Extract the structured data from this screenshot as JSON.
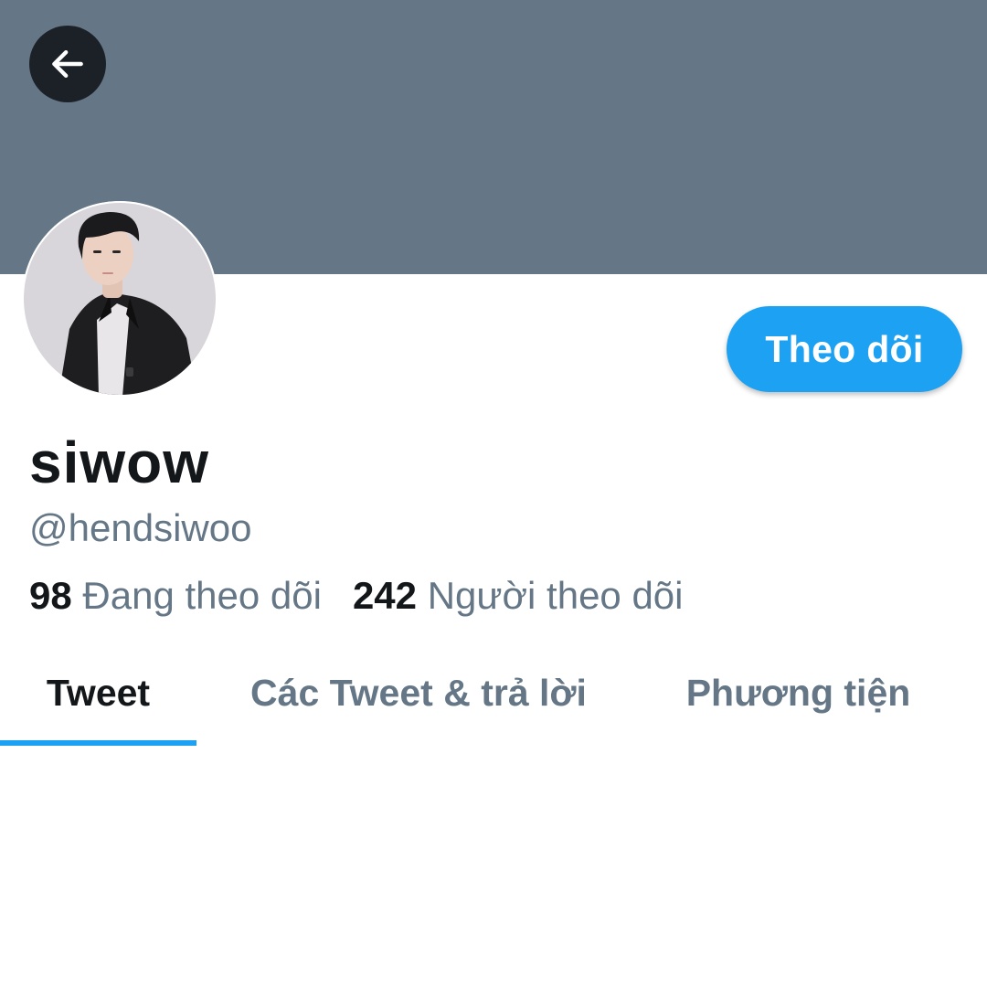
{
  "colors": {
    "banner": "#657786",
    "accent": "#1da1f2",
    "primary_text": "#14171a",
    "secondary_text": "#657786"
  },
  "header": {
    "back_icon": "arrow-left-icon"
  },
  "profile": {
    "display_name": "siwow",
    "handle": "@hendsiwoo",
    "follow_label": "Theo dõi",
    "stats": {
      "following_count": "98",
      "following_label": "Đang theo dõi",
      "followers_count": "242",
      "followers_label": "Người theo dõi"
    }
  },
  "tabs": [
    {
      "label": "Tweet",
      "active": true
    },
    {
      "label": "Các Tweet & trả lời",
      "active": false
    },
    {
      "label": "Phương tiện",
      "active": false
    }
  ]
}
